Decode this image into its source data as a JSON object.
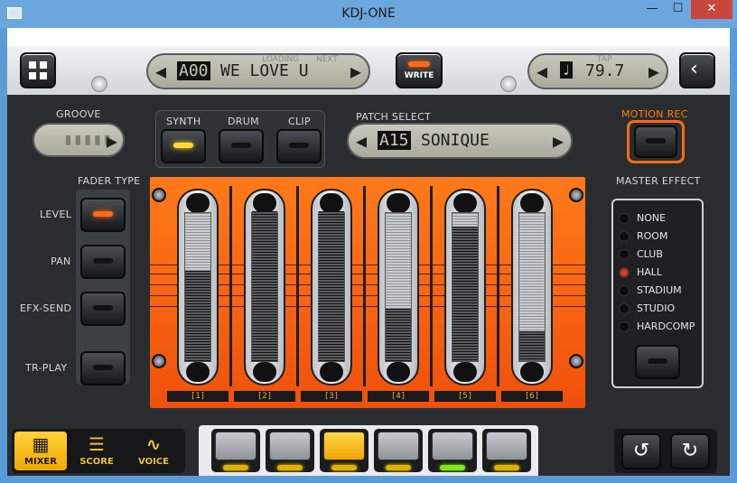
{
  "window": {
    "title": "KDJ-ONE",
    "minimize": "—",
    "maximize": "☐",
    "close": "✕"
  },
  "top": {
    "song_index": "A00",
    "song_name": "WE LOVE U",
    "song_loading": "LOADING",
    "song_next": "NEXT",
    "write_label": "WRITE",
    "tempo_label": "TAP",
    "tempo_value": "79.7",
    "back_icon": "back-icon",
    "grid_icon": "grid-icon"
  },
  "groove": {
    "label": "GROOVE"
  },
  "tabs": {
    "synth": "SYNTH",
    "drum": "DRUM",
    "clip": "CLIP",
    "active": "SYNTH"
  },
  "patch": {
    "label": "PATCH SELECT",
    "index": "A15",
    "name": "SONIQUE"
  },
  "motion": {
    "label": "MOTION REC"
  },
  "fader_type": {
    "label": "FADER TYPE",
    "items": [
      {
        "label": "LEVEL",
        "active": true
      },
      {
        "label": "PAN",
        "active": false
      },
      {
        "label": "EFX-SEND",
        "active": false
      },
      {
        "label": "TR-PLAY",
        "active": false
      }
    ]
  },
  "faders": [
    {
      "channel": "[1]",
      "level": 0.6
    },
    {
      "channel": "[2]",
      "level": 1.0
    },
    {
      "channel": "[3]",
      "level": 1.0
    },
    {
      "channel": "[4]",
      "level": 0.35
    },
    {
      "channel": "[5]",
      "level": 0.9
    },
    {
      "channel": "[6]",
      "level": 0.2
    }
  ],
  "master_effect": {
    "label": "MASTER EFFECT",
    "options": [
      "NONE",
      "ROOM",
      "CLUB",
      "HALL",
      "STADIUM",
      "STUDIO",
      "HARDCOMP"
    ],
    "selected": "HALL"
  },
  "modes": [
    {
      "label": "MIXER",
      "active": true
    },
    {
      "label": "SCORE",
      "active": false
    },
    {
      "label": "VOICE",
      "active": false
    }
  ],
  "pads": [
    {
      "active": false,
      "led": "yellow"
    },
    {
      "active": false,
      "led": "yellow"
    },
    {
      "active": true,
      "led": "yellow"
    },
    {
      "active": false,
      "led": "yellow"
    },
    {
      "active": false,
      "led": "green"
    },
    {
      "active": false,
      "led": "yellow"
    }
  ],
  "undo": {
    "glyph": "↺"
  },
  "redo": {
    "glyph": "↻"
  },
  "colors": {
    "accent": "#ff6a1a",
    "led_yellow": "#ffd93b",
    "led_green": "#7fe81a"
  }
}
